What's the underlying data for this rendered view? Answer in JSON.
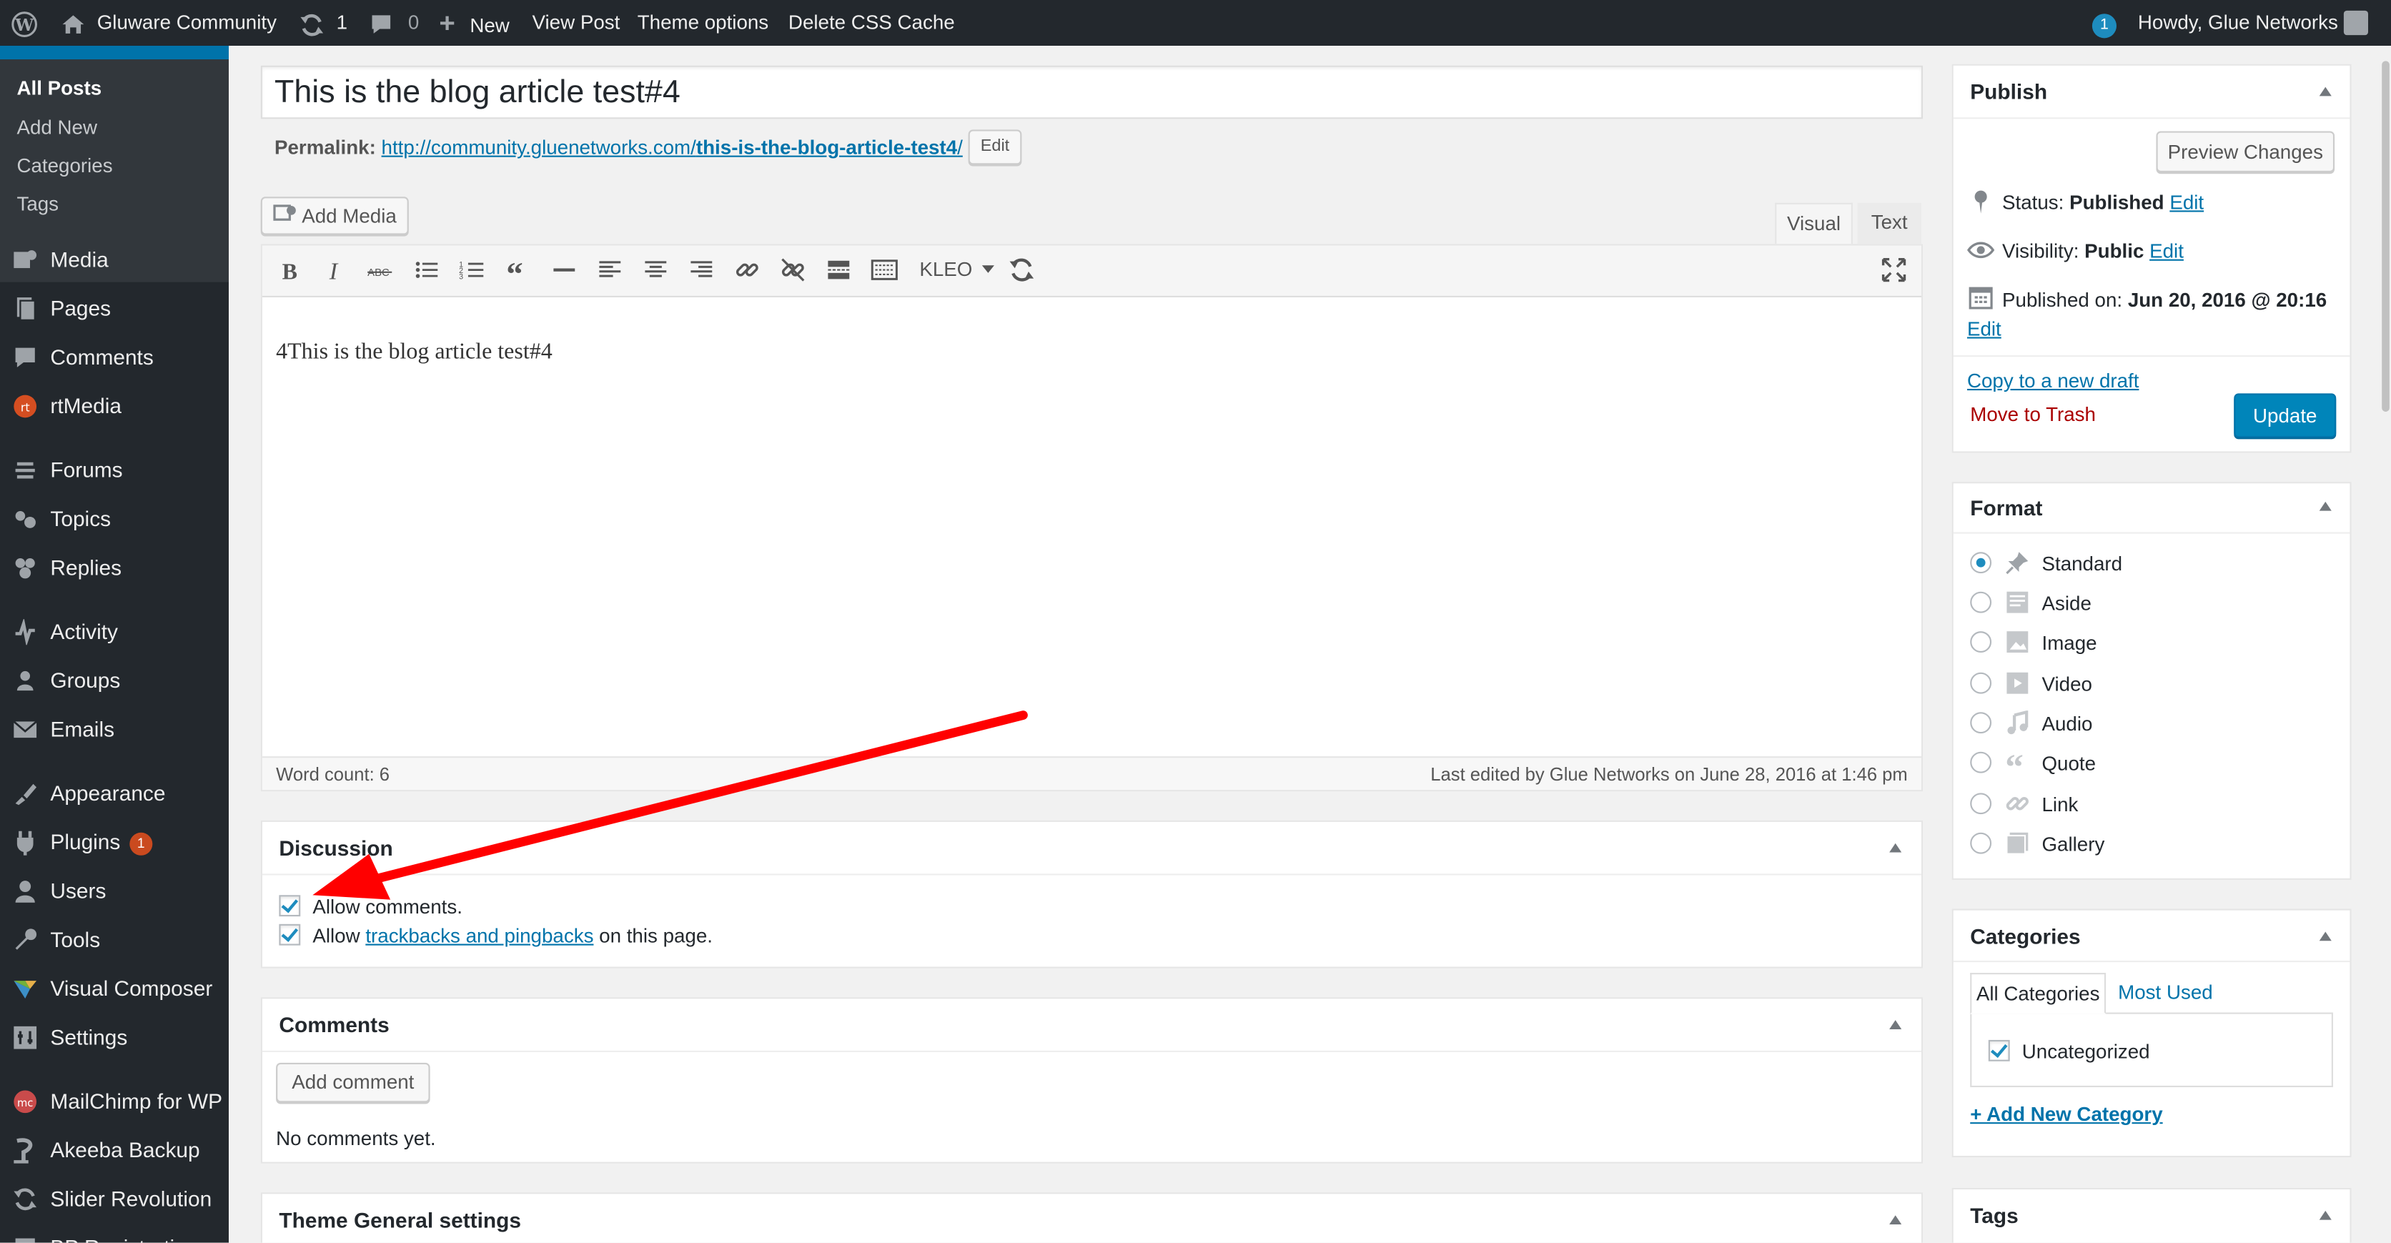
{
  "admin_bar": {
    "site_name": "Gluware Community",
    "updates_count": "1",
    "comments_count": "0",
    "new_label": "New",
    "view_post": "View Post",
    "theme_options": "Theme options",
    "delete_css_cache": "Delete CSS Cache",
    "notification_count": "1",
    "howdy": "Howdy, Glue Networks"
  },
  "sidebar": {
    "submenu": [
      "All Posts",
      "Add New",
      "Categories",
      "Tags"
    ],
    "items": [
      {
        "label": "Media",
        "icon": "media-icon"
      },
      {
        "label": "Pages",
        "icon": "pages-icon"
      },
      {
        "label": "Comments",
        "icon": "comments-icon"
      },
      {
        "label": "rtMedia",
        "icon": "rtmedia-icon"
      },
      {
        "label": "Forums",
        "icon": "forums-icon"
      },
      {
        "label": "Topics",
        "icon": "topics-icon"
      },
      {
        "label": "Replies",
        "icon": "replies-icon"
      },
      {
        "label": "Activity",
        "icon": "activity-icon"
      },
      {
        "label": "Groups",
        "icon": "groups-icon"
      },
      {
        "label": "Emails",
        "icon": "emails-icon"
      },
      {
        "label": "Appearance",
        "icon": "appearance-icon"
      },
      {
        "label": "Plugins",
        "icon": "plugins-icon",
        "badge": "1"
      },
      {
        "label": "Users",
        "icon": "users-icon"
      },
      {
        "label": "Tools",
        "icon": "tools-icon"
      },
      {
        "label": "Visual Composer",
        "icon": "visual-composer-icon"
      },
      {
        "label": "Settings",
        "icon": "settings-icon"
      },
      {
        "label": "MailChimp for WP",
        "icon": "mailchimp-icon"
      },
      {
        "label": "Akeeba Backup",
        "icon": "akeeba-icon"
      },
      {
        "label": "Slider Revolution",
        "icon": "slider-revolution-icon"
      },
      {
        "label": "BP Registration",
        "icon": "bp-registration-icon"
      }
    ]
  },
  "editor": {
    "title": "This is the blog article test#4",
    "permalink_label": "Permalink:",
    "permalink_base": "http://community.gluenetworks.com/",
    "permalink_slug": "this-is-the-blog-article-test4",
    "permalink_trailing": "/",
    "edit_button": "Edit",
    "add_media": "Add Media",
    "tab_visual": "Visual",
    "tab_text": "Text",
    "format_dropdown": "KLEO",
    "content": "4This is the blog article test#4",
    "word_count": "Word count: 6",
    "last_edited": "Last edited by Glue Networks on June 28, 2016 at 1:46 pm"
  },
  "discussion": {
    "title": "Discussion",
    "allow_comments": "Allow comments.",
    "allow_pre": "Allow ",
    "allow_link": "trackbacks and pingbacks",
    "allow_post": " on this page."
  },
  "comments": {
    "title": "Comments",
    "add_comment": "Add comment",
    "none": "No comments yet."
  },
  "theme_settings": {
    "title": "Theme General settings"
  },
  "publish": {
    "title": "Publish",
    "preview": "Preview Changes",
    "status_label": "Status:",
    "status_value": "Published",
    "visibility_label": "Visibility:",
    "visibility_value": "Public",
    "published_label": "Published on:",
    "published_value": "Jun 20, 2016 @ 20:16",
    "edit": "Edit",
    "copy_draft": "Copy to a new draft",
    "trash": "Move to Trash",
    "update": "Update"
  },
  "format_box": {
    "title": "Format",
    "options": [
      "Standard",
      "Aside",
      "Image",
      "Video",
      "Audio",
      "Quote",
      "Link",
      "Gallery"
    ],
    "selected": "Standard"
  },
  "categories_box": {
    "title": "Categories",
    "tab_all": "All Categories",
    "tab_used": "Most Used",
    "item": "Uncategorized",
    "add_new": "+ Add New Category"
  },
  "tags_box": {
    "title": "Tags"
  },
  "colors": {
    "admin_bar": "#23282d",
    "primary": "#0073aa",
    "danger": "#a00",
    "annotation_arrow": "#ff0000"
  }
}
